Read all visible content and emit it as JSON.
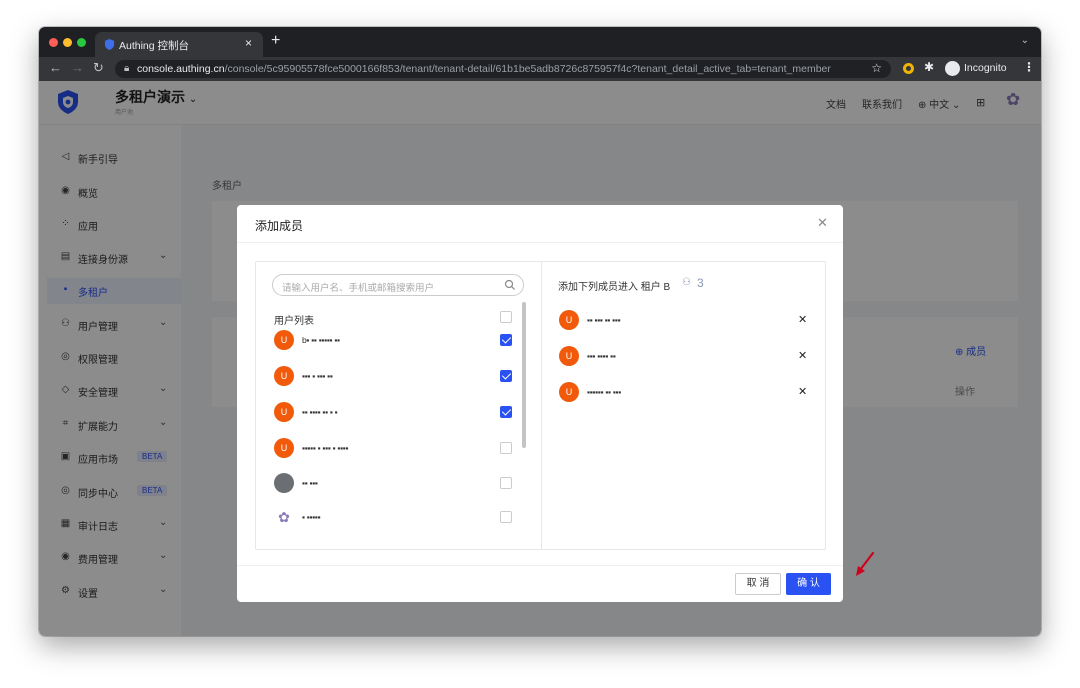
{
  "browser": {
    "tab_title": "Authing 控制台",
    "tab_close": "×",
    "new_tab": "+",
    "url_host": "console.authing.cn",
    "url_path": "/console/5c95905578fce5000166f853/tenant/tenant-detail/61b1be5adb8726c875957f4c?tenant_detail_active_tab=tenant_member",
    "incognito_label": "Incognito"
  },
  "header": {
    "project_name": "多租户演示",
    "project_sub": "用户池",
    "links": [
      "文档",
      "联系我们",
      "中文"
    ]
  },
  "sidebar": {
    "items": [
      {
        "icon": "◁",
        "label": "新手引导",
        "chevron": false
      },
      {
        "icon": "◉",
        "label": "概览",
        "chevron": false
      },
      {
        "icon": "⁘",
        "label": "应用",
        "chevron": false
      },
      {
        "icon": "▤",
        "label": "连接身份源",
        "chevron": true
      },
      {
        "icon": "▪",
        "label": "多租户",
        "chevron": false,
        "active": true
      },
      {
        "icon": "⚇",
        "label": "用户管理",
        "chevron": true
      },
      {
        "icon": "◎",
        "label": "权限管理",
        "chevron": false
      },
      {
        "icon": "◇",
        "label": "安全管理",
        "chevron": true
      },
      {
        "icon": "⌗",
        "label": "扩展能力",
        "chevron": true
      },
      {
        "icon": "▣",
        "label": "应用市场",
        "badge": "BETA"
      },
      {
        "icon": "◎",
        "label": "同步中心",
        "badge": "BETA"
      },
      {
        "icon": "▦",
        "label": "审计日志",
        "chevron": true
      },
      {
        "icon": "◉",
        "label": "费用管理",
        "chevron": true
      },
      {
        "icon": "⚙",
        "label": "设置",
        "chevron": true
      }
    ]
  },
  "main": {
    "breadcrumb": "多租户",
    "add_member": "⊕ 成员",
    "op_header": "操作"
  },
  "modal": {
    "title": "添加成员",
    "search_placeholder": "请输入用户名、手机或邮箱搜索用户",
    "list_header": "用户列表",
    "users": [
      {
        "name": "b▪ ▪▪ ▪▪▪▪▪ ▪▪",
        "avatar": "U",
        "checked": true
      },
      {
        "name": "▪▪▪ ▪ ▪▪▪ ▪▪",
        "avatar": "U",
        "checked": true
      },
      {
        "name": "▪▪ ▪▪▪▪ ▪▪ ▪ ▪",
        "avatar": "U",
        "checked": true
      },
      {
        "name": "▪▪▪▪▪ ▪ ▪▪▪ ▪ ▪▪▪▪",
        "avatar": "U",
        "checked": false
      },
      {
        "name": "▪▪ ▪▪▪",
        "avatar": "",
        "checked": false
      },
      {
        "name": "▪ ▪▪▪▪▪",
        "avatar": "✿",
        "checked": false
      }
    ],
    "right_header": "添加下列成员进入 租户 B",
    "selected_count": "3",
    "selected": [
      {
        "name": "▪▪ ▪▪▪ ▪▪ ▪▪▪",
        "avatar": "U"
      },
      {
        "name": "▪▪▪ ▪▪▪▪ ▪▪",
        "avatar": "U"
      },
      {
        "name": "▪▪▪▪▪▪ ▪▪ ▪▪▪",
        "avatar": "U"
      }
    ],
    "cancel_label": "取 消",
    "confirm_label": "确 认"
  },
  "colors": {
    "accent": "#2a52f3",
    "avatar": "#f15a0a",
    "arrow": "#d0021b"
  }
}
